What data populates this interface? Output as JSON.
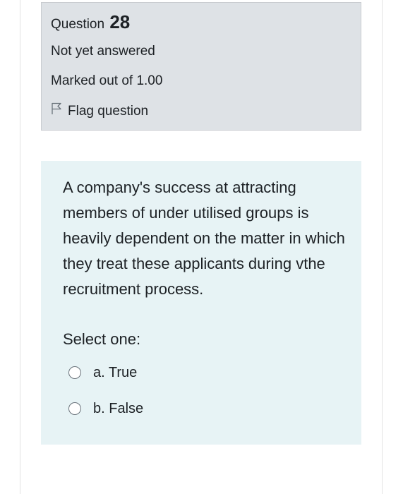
{
  "question": {
    "label": "Question",
    "number": "28",
    "state": "Not yet answered",
    "grade": "Marked out of 1.00",
    "flag_label": "Flag question",
    "text": "A company's success at attracting members of under utilised groups is heavily dependent on the matter in which they treat these applicants during vthe recruitment process.",
    "prompt": "Select one:",
    "options": [
      {
        "label": "a. True",
        "selected": false
      },
      {
        "label": "b. False",
        "selected": false
      }
    ]
  },
  "colors": {
    "info_background": "#dee2e6",
    "content_background": "#e7f3f5",
    "text": "#1d2125"
  }
}
